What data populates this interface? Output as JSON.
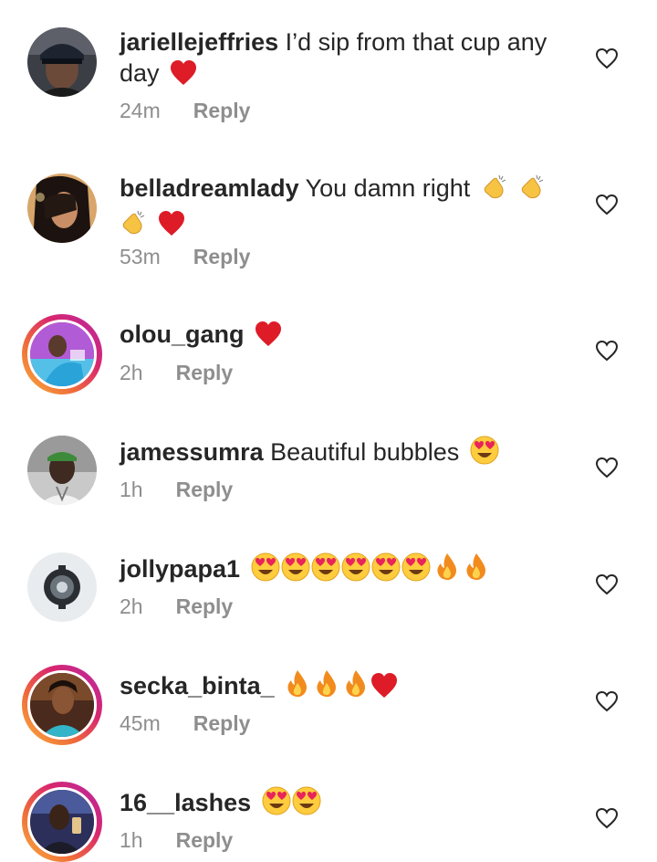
{
  "comments": [
    {
      "username": "jariellejeffries",
      "text": "I’d sip from that cup any day",
      "time": "24m",
      "reply_label": "Reply",
      "emojis": [
        "red-heart"
      ]
    },
    {
      "username": "belladreamlady",
      "text": "You damn right",
      "time": "53m",
      "reply_label": "Reply",
      "emojis": [
        "clapping-hands",
        "clapping-hands",
        "clapping-hands",
        "red-heart"
      ]
    },
    {
      "username": "olou_gang",
      "text": "",
      "time": "2h",
      "reply_label": "Reply",
      "emojis": [
        "red-heart"
      ]
    },
    {
      "username": "jamessumra",
      "text": "Beautiful bubbles",
      "time": "1h",
      "reply_label": "Reply",
      "emojis": [
        "heart-eyes-face"
      ]
    },
    {
      "username": "jollypapa1",
      "text": "",
      "time": "2h",
      "reply_label": "Reply",
      "emojis": [
        "heart-eyes-face",
        "heart-eyes-face",
        "heart-eyes-face",
        "heart-eyes-face",
        "heart-eyes-face",
        "heart-eyes-face",
        "fire",
        "fire"
      ]
    },
    {
      "username": "secka_binta_",
      "text": "",
      "time": "45m",
      "reply_label": "Reply",
      "emojis": [
        "fire",
        "fire",
        "fire",
        "red-heart"
      ]
    },
    {
      "username": "16__lashes",
      "text": "",
      "time": "1h",
      "reply_label": "Reply",
      "emojis": [
        "heart-eyes-face",
        "heart-eyes-face"
      ]
    }
  ],
  "icons": {
    "like": "heart-outline-icon"
  },
  "colors": {
    "text": "#262626",
    "secondary": "#8e8e8e",
    "story_ring_start": "#f9b13b",
    "story_ring_end": "#b62ba6"
  }
}
